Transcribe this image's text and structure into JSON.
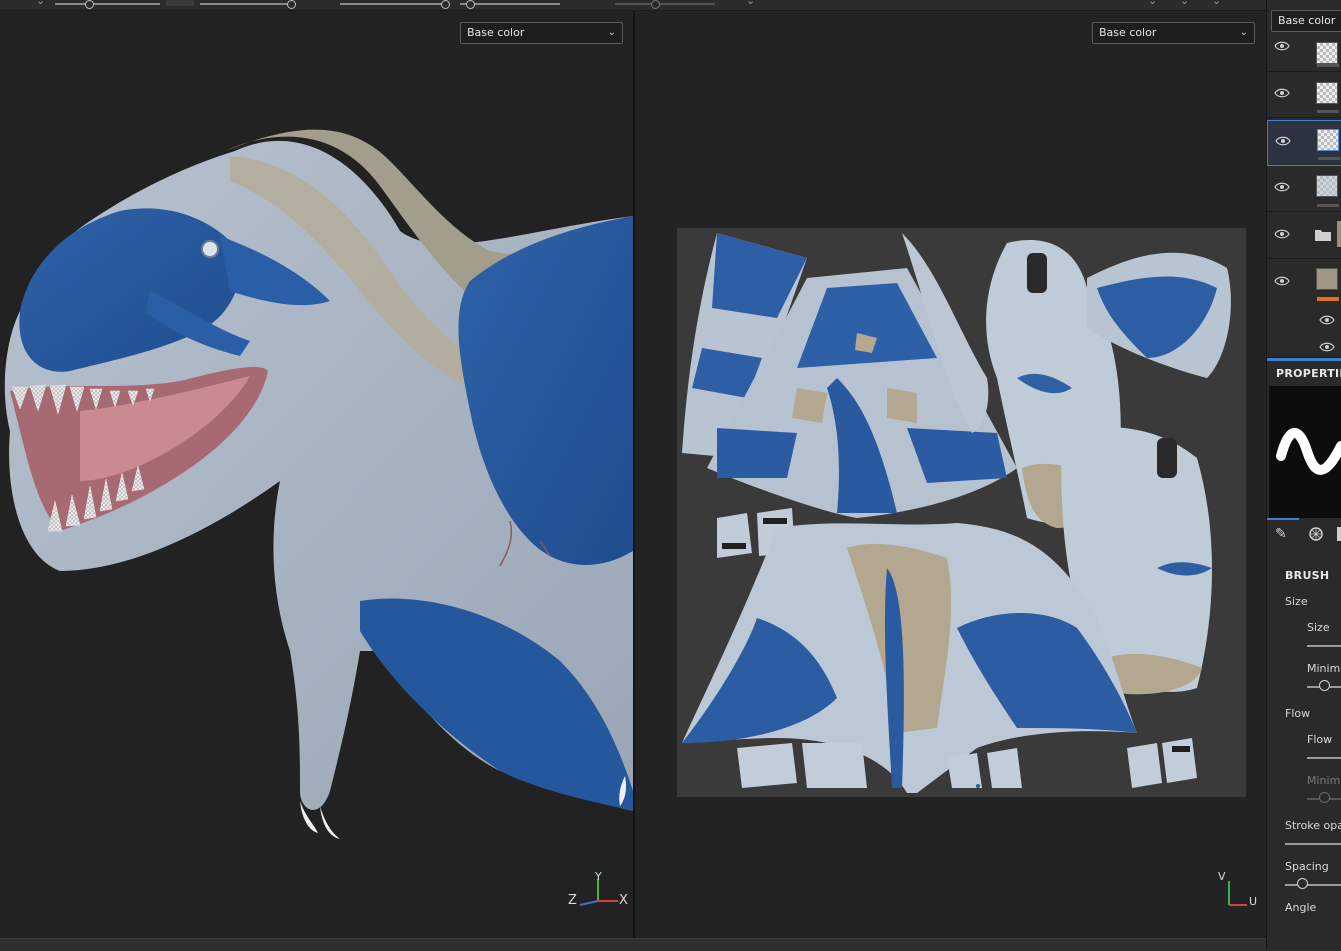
{
  "viewport_3d": {
    "channel": "Base color",
    "gizmo_axes": [
      "Z",
      "Y",
      "X"
    ]
  },
  "viewport_2d": {
    "channel": "Base color",
    "axes": [
      "V",
      "U"
    ]
  },
  "layer_panel": {
    "channel": "Base color",
    "layer_count": 7
  },
  "properties": {
    "title": "PROPERTIES",
    "brush_section": "BRUSH",
    "size_group": "Size",
    "size_label": "Size",
    "minimum_label": "Minimum",
    "flow_group": "Flow",
    "flow_label": "Flow",
    "flow_minimum_label": "Minimum",
    "stroke_opacity_label": "Stroke opacity",
    "spacing_label": "Spacing",
    "angle_label": "Angle"
  },
  "colors": {
    "accent": "#3f7fd1",
    "panel_bg": "#2a2a2a",
    "viewport_bg": "#222222",
    "orange_tag": "#e07020"
  }
}
